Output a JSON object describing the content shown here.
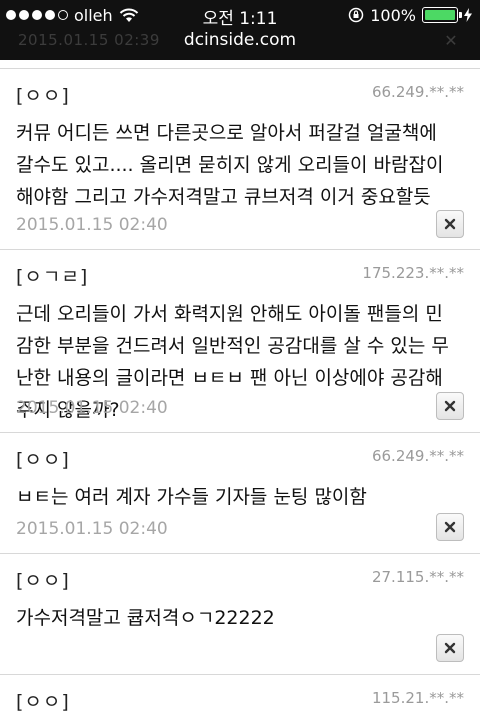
{
  "status_bar": {
    "carrier": "olleh",
    "time": "오전 1:11",
    "battery": "100%"
  },
  "url_bar": {
    "domain": "dcinside.com"
  },
  "ghost_row": {
    "date": "2015.01.15 02:39"
  },
  "comments": [
    {
      "author": "[ㅇㅇ]",
      "ip": "66.249.**.**",
      "text": "커뮤 어디든 쓰면 다른곳으로 알아서 퍼갈걸 얼굴책에 갈수도 있고.... 올리면 묻히지 않게 오리들이 바람잡이 해야함 그리고 가수저격말고 큐브저격 이거 중요할듯",
      "date": "2015.01.15 02:40"
    },
    {
      "author": "[ㅇㄱㄹ]",
      "ip": "175.223.**.**",
      "text": "근데 오리들이 가서 화력지원 안해도 아이돌 팬들의 민감한 부분을 건드려서 일반적인 공감대를 살 수 있는 무난한 내용의 글이라면 ㅂㅌㅂ 팬 아닌 이상에야 공감해주지 않을까?",
      "date": "2015.01.15 02:40"
    },
    {
      "author": "[ㅇㅇ]",
      "ip": "66.249.**.**",
      "text": "ㅂㅌ는 여러 계자 가수들 기자들 눈팅 많이함",
      "date": "2015.01.15 02:40"
    },
    {
      "author": "[ㅇㅇ]",
      "ip": "27.115.**.**",
      "text": "가수저격말고 큡저격ㅇㄱ22222",
      "date": ""
    },
    {
      "author": "[ㅇㅇ]",
      "ip": "115.21.**.**",
      "text": "",
      "date": ""
    }
  ]
}
